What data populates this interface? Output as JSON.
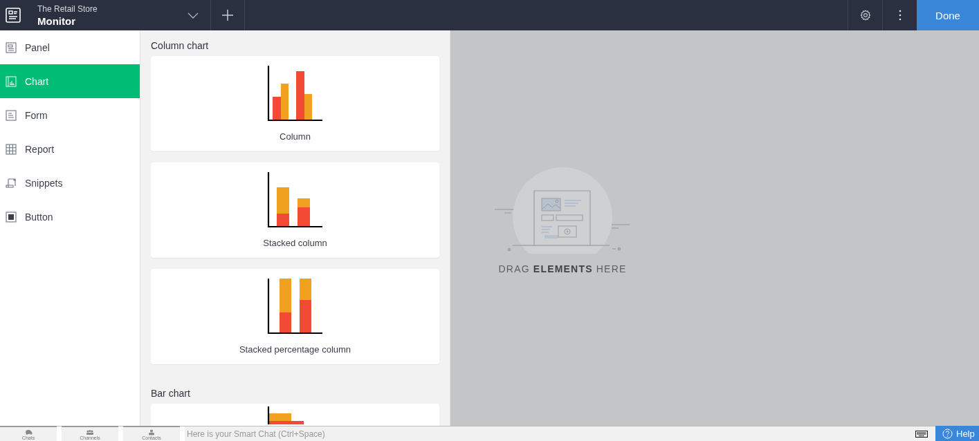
{
  "header": {
    "app_name": "The Retail Store",
    "page_title": "Monitor",
    "done_button": "Done"
  },
  "sidebar": {
    "items": [
      {
        "label": "Panel",
        "kind": "panel",
        "selected": false
      },
      {
        "label": "Chart",
        "kind": "chart",
        "selected": true
      },
      {
        "label": "Form",
        "kind": "form",
        "selected": false
      },
      {
        "label": "Report",
        "kind": "report",
        "selected": false
      },
      {
        "label": "Snippets",
        "kind": "snippets",
        "selected": false
      },
      {
        "label": "Button",
        "kind": "button",
        "selected": false
      }
    ]
  },
  "gallery": {
    "sections": [
      {
        "title": "Column chart",
        "cards": [
          {
            "label": "Column",
            "kind": "column"
          },
          {
            "label": "Stacked column",
            "kind": "stacked"
          },
          {
            "label": "Stacked percentage column",
            "kind": "percent"
          }
        ]
      },
      {
        "title": "Bar chart",
        "cards": [
          {
            "kind": "bar"
          }
        ]
      }
    ]
  },
  "canvas": {
    "message": "DRAG **ELEMENTS** HERE"
  },
  "chat_bar": {
    "tabs": [
      "Chats",
      "Channels",
      "Contacts"
    ],
    "placeholder": "Here is your Smart Chat (Ctrl+Space)",
    "help_button": "Help"
  }
}
